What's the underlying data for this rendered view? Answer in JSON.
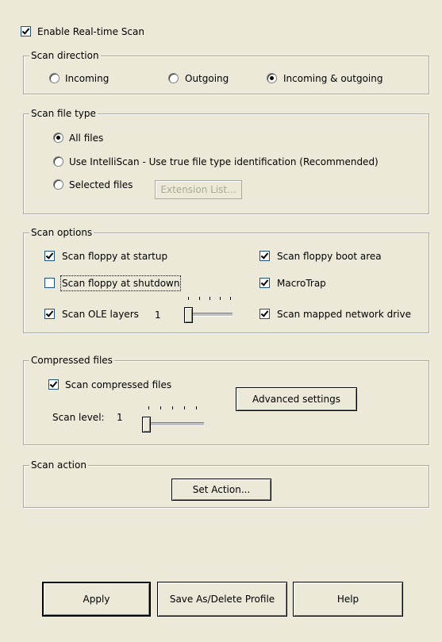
{
  "enable_realtime": {
    "label": "Enable Real-time Scan",
    "checked": true
  },
  "scan_direction": {
    "title": "Scan direction",
    "options": [
      {
        "label": "Incoming",
        "selected": false
      },
      {
        "label": "Outgoing",
        "selected": false
      },
      {
        "label": "Incoming & outgoing",
        "selected": true
      }
    ]
  },
  "scan_file_type": {
    "title": "Scan file type",
    "options": [
      {
        "label": "All files",
        "selected": true
      },
      {
        "label": "Use IntelliScan - Use true file type identification (Recommended)",
        "selected": false
      },
      {
        "label": "Selected files",
        "selected": false
      }
    ],
    "extension_button": "Extension List..."
  },
  "scan_options": {
    "title": "Scan options",
    "floppy_startup": {
      "label": "Scan floppy at startup",
      "checked": true
    },
    "floppy_shutdown": {
      "label": "Scan floppy at shutdown",
      "checked": false
    },
    "ole_layers": {
      "label": "Scan OLE layers",
      "checked": true,
      "value": "1"
    },
    "floppy_boot": {
      "label": "Scan floppy boot area",
      "checked": true
    },
    "macrotrap": {
      "label": "MacroTrap",
      "checked": true
    },
    "mapped_drive": {
      "label": "Scan mapped network drive",
      "checked": true
    }
  },
  "compressed_files": {
    "title": "Compressed files",
    "scan_compressed": {
      "label": "Scan compressed files",
      "checked": true
    },
    "advanced_button": "Advanced settings",
    "scan_level_label": "Scan level:",
    "scan_level_value": "1"
  },
  "scan_action": {
    "title": "Scan action",
    "set_action_button": "Set Action..."
  },
  "footer": {
    "apply": "Apply",
    "save_profile": "Save As/Delete Profile",
    "help": "Help"
  }
}
